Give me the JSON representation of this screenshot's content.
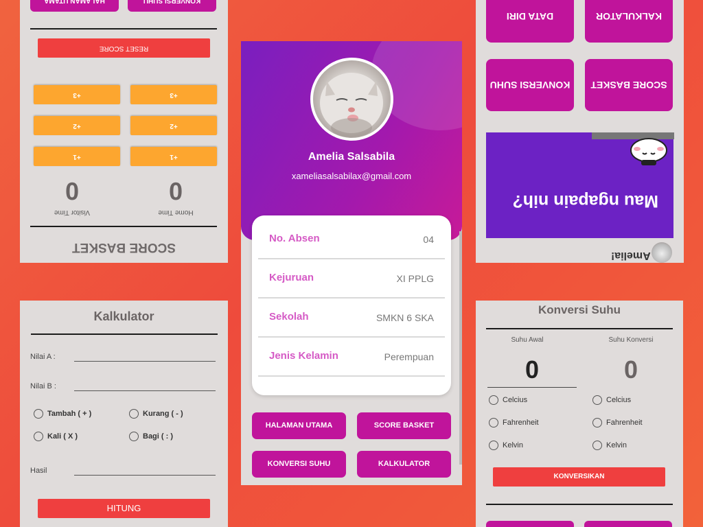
{
  "score_screen": {
    "title": "SCORE BASKET",
    "home_label": "Home Time",
    "visitor_label": "Visitor Time",
    "home_score": "0",
    "visitor_score": "0",
    "buttons": [
      "+1",
      "+2",
      "+3"
    ],
    "reset_label": "RESET SCORE",
    "nav_left": "HALAMAN UTAMA",
    "nav_right": "KONVERSI SUHU"
  },
  "home_screen": {
    "greeting": "Hi, Amelia!",
    "banner_text": "Mau ngapain nih?",
    "tiles": [
      "SCORE BASKET",
      "KONVERSI SUHU",
      "KALKULATOR",
      "DATA DIRI"
    ]
  },
  "profile": {
    "name": "Amelia Salsabila",
    "email": "xameliasalsabilax@gmail.com",
    "rows": [
      {
        "label": "No. Absen",
        "value": "04"
      },
      {
        "label": "Kejuruan",
        "value": "XI PPLG"
      },
      {
        "label": "Sekolah",
        "value": "SMKN 6 SKA"
      },
      {
        "label": "Jenis Kelamin",
        "value": "Perempuan"
      }
    ],
    "buttons": [
      "HALAMAN UTAMA",
      "SCORE BASKET",
      "KONVERSI SUHU",
      "KALKULATOR"
    ]
  },
  "calculator": {
    "title": "Kalkulator",
    "label_a": "Nilai A :",
    "label_b": "Nilai B :",
    "ops": [
      "Tambah ( + )",
      "Kurang ( - )",
      "Kali ( X )",
      "Bagi ( : )"
    ],
    "result_label": "Hasil",
    "button": "HITUNG"
  },
  "temperature": {
    "title": "Konversi Suhu",
    "col_from": "Suhu Awal",
    "col_to": "Suhu Konversi",
    "value_from": "0",
    "value_to": "0",
    "units": [
      "Celcius",
      "Fahrenheit",
      "Kelvin"
    ],
    "button": "KONVERSIKAN"
  },
  "colors": {
    "primary": "#c0149b",
    "accent_red": "#ef3f3f",
    "orange": "#fda62f",
    "purple": "#6c22c4"
  }
}
